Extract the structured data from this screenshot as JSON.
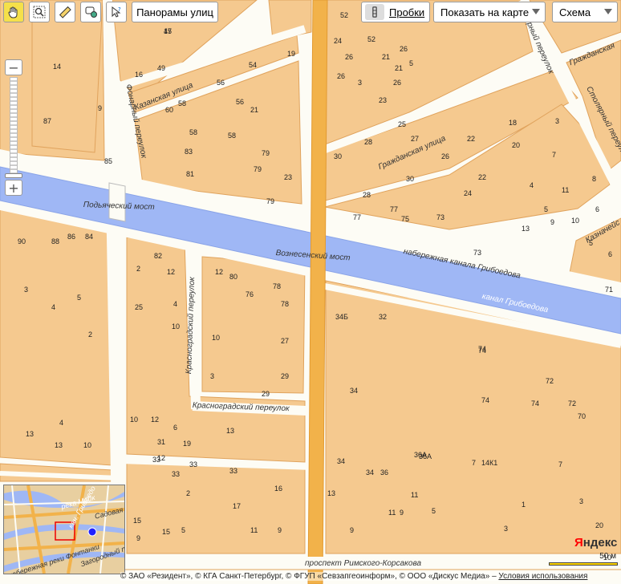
{
  "toolbar": {
    "panoramas_label": "Панорамы улиц",
    "traffic_label": "Пробки",
    "show_on_map_label": "Показать на карте",
    "scheme_label": "Схема"
  },
  "streets": {
    "kazanskaya": "Казанская улица",
    "fonarny": "Фонарный переулок",
    "podyachesky_bridge": "Подьяческий мост",
    "voznesensky_bridge": "Вознесенский мост",
    "griboedov_emb": "набережная канала Грибоедова",
    "griboedov_canal": "канал Грибоедова",
    "grazhdanskaya": "Гражданская улица",
    "stolyarny": "Столярный переулок",
    "grazhdanskaya_top": "Гражданская",
    "krasnogradsky_v": "Красноградский переулок",
    "krasnogradsky_h": "Красноградский переулок",
    "rimsky": "проспект Римского-Корсакова",
    "kaznacheyskaya": "Казначейс",
    "rny_pereulok": "рный переулок"
  },
  "house_numbers": [
    "47",
    "49",
    "16",
    "14",
    "9",
    "87",
    "85",
    "54",
    "19",
    "56",
    "60",
    "58",
    "56",
    "21",
    "58",
    "58",
    "83",
    "81",
    "79",
    "79",
    "23",
    "79",
    "52",
    "24",
    "52",
    "26",
    "21",
    "26",
    "5",
    "21",
    "26",
    "3",
    "23",
    "26",
    "30",
    "25",
    "28",
    "27",
    "30",
    "26",
    "22",
    "18",
    "20",
    "24",
    "28",
    "77",
    "77",
    "75",
    "73",
    "73",
    "22",
    "13",
    "11",
    "5",
    "4",
    "3",
    "7",
    "10",
    "8",
    "6",
    "9",
    "5",
    "90",
    "88",
    "86",
    "84",
    "82",
    "2",
    "12",
    "80",
    "78",
    "76",
    "78",
    "25",
    "4",
    "10",
    "27",
    "3",
    "29",
    "29",
    "34Б",
    "32",
    "74",
    "74",
    "72",
    "70",
    "74",
    "72",
    "74",
    "34",
    "36А",
    "36А",
    "34",
    "34",
    "36",
    "13",
    "9",
    "11",
    "11",
    "9",
    "5",
    "3",
    "1",
    "7",
    "7",
    "14К1",
    "13",
    "13",
    "10",
    "10",
    "12",
    "12",
    "33",
    "33",
    "33",
    "33",
    "16",
    "17",
    "15",
    "15",
    "5",
    "11",
    "9",
    "2",
    "31",
    "4",
    "13",
    "19",
    "6",
    "9",
    "3",
    "5",
    "4",
    "2",
    "12",
    "10",
    "71",
    "6",
    "3",
    "20",
    "10",
    "15"
  ],
  "minimap": {
    "label_moyka": "река Мойк",
    "label_sadovaya": "Садовая у",
    "label_griboed": "кан. Грибоедо",
    "label_fontanka": "набережная реки Фонтанки",
    "label_zagorodny": "Загородный пр"
  },
  "copyright": {
    "text": "© ЗАО «Резидент», © КГА Санкт-Петербург, © ФГУП «Севзапгеоинформ», © ООО «Дискус Медиа» –",
    "terms": "Условия использования"
  },
  "logo": {
    "y": "Я",
    "rest": "ндекс"
  },
  "scale_label": "50 м",
  "colors": {
    "block": "#f5c98f",
    "block_stroke": "#e0a35d",
    "street": "#fdfcf5",
    "water": "#9fb7f5",
    "main_road": "#f2b24a",
    "tool_active": "#f5e04a"
  }
}
